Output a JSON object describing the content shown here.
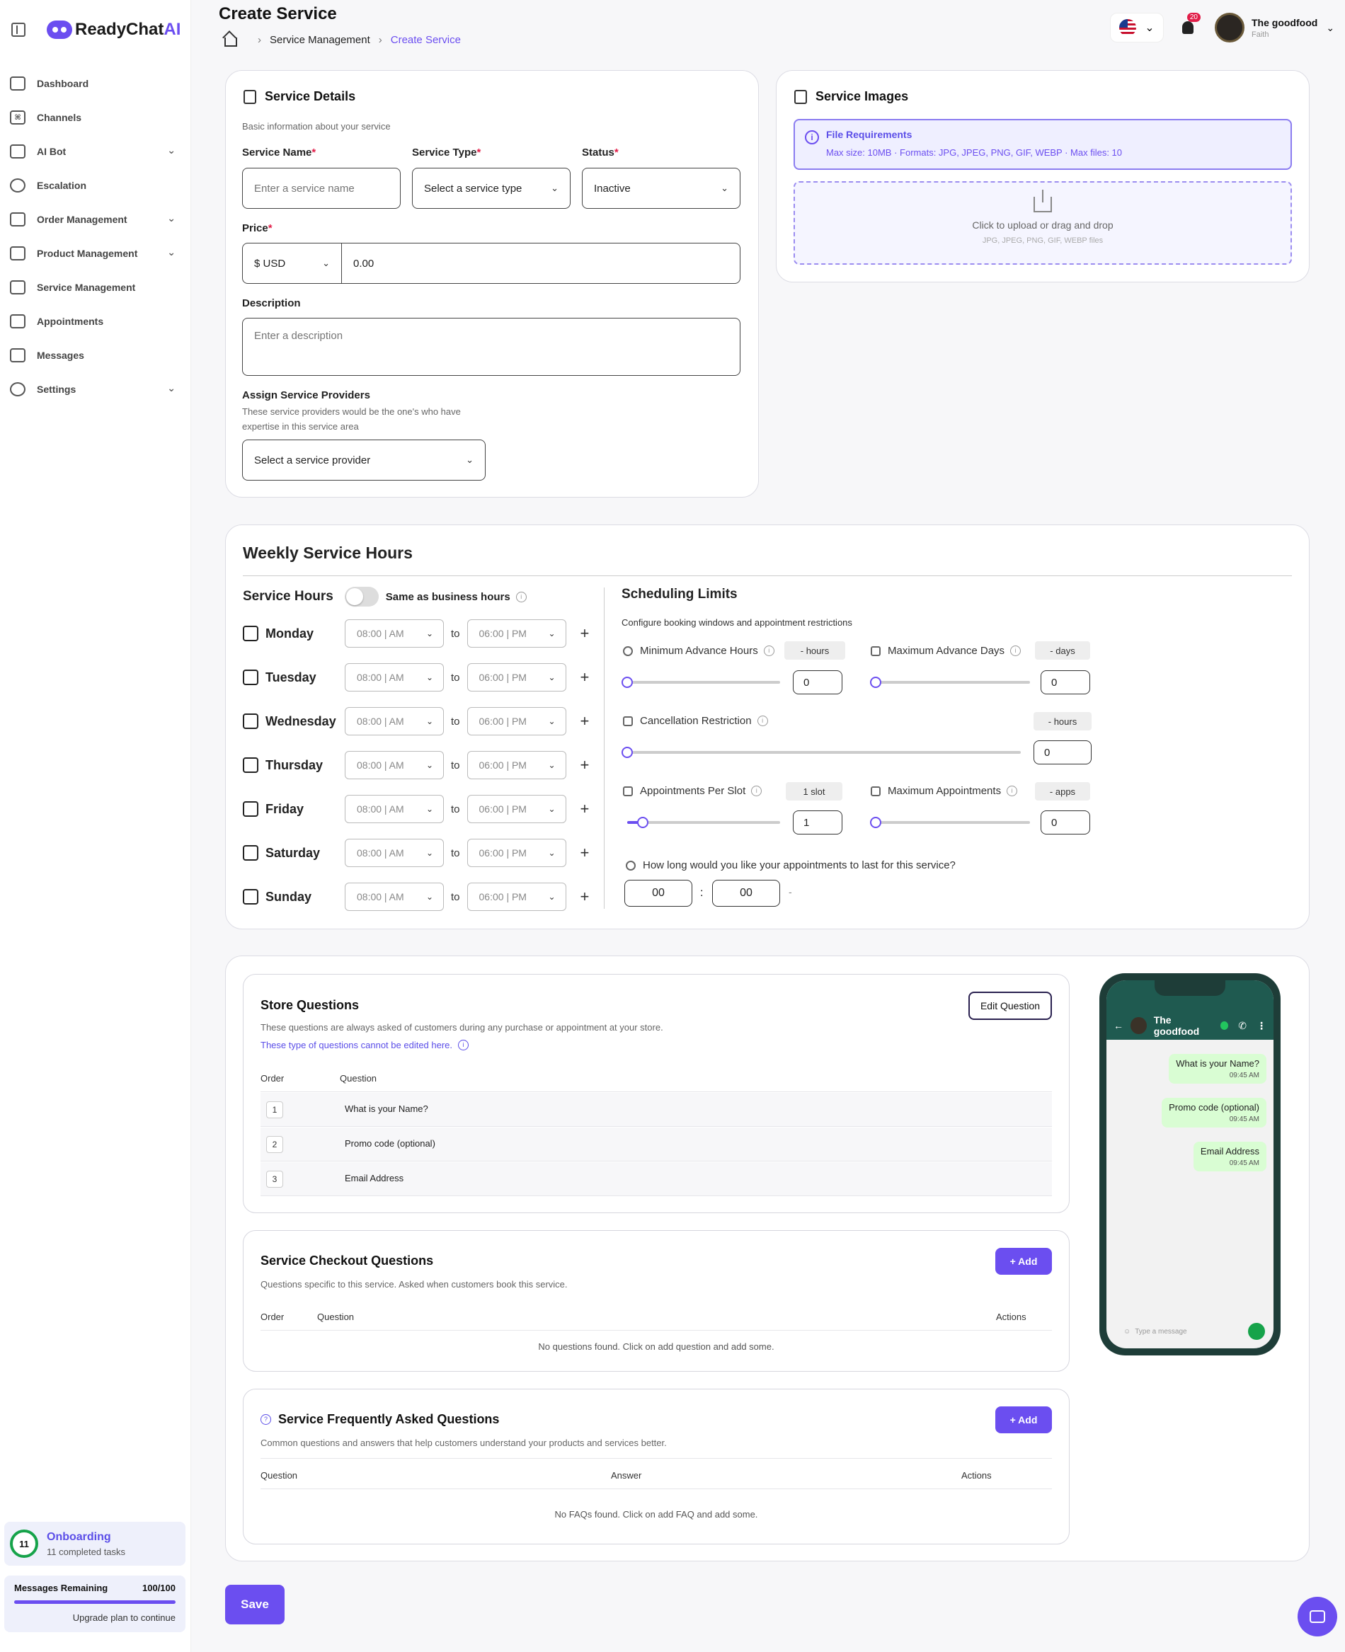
{
  "app": {
    "logo_main": "ReadyChat",
    "logo_ai": "AI"
  },
  "sidebar": {
    "items": [
      {
        "label": "Dashboard",
        "icon": "grid-icon",
        "has_children": false
      },
      {
        "label": "Channels",
        "icon": "command-icon",
        "has_children": false
      },
      {
        "label": "AI Bot",
        "icon": "bot-icon",
        "has_children": true
      },
      {
        "label": "Escalation",
        "icon": "headset-icon",
        "has_children": false
      },
      {
        "label": "Order Management",
        "icon": "box-icon",
        "has_children": true
      },
      {
        "label": "Product Management",
        "icon": "basket-icon",
        "has_children": true
      },
      {
        "label": "Service Management",
        "icon": "briefcase-icon",
        "has_children": false
      },
      {
        "label": "Appointments",
        "icon": "calendar-icon",
        "has_children": false
      },
      {
        "label": "Messages",
        "icon": "message-icon",
        "has_children": false
      },
      {
        "label": "Settings",
        "icon": "gear-icon",
        "has_children": true
      }
    ],
    "onboarding": {
      "count": "11",
      "title": "Onboarding",
      "subtitle": "11 completed tasks"
    },
    "messages": {
      "label": "Messages Remaining",
      "value": "100/100",
      "upgrade": "Upgrade plan to continue",
      "fraction": 1.0
    }
  },
  "header": {
    "title": "Create Service",
    "breadcrumb": [
      "Service Management",
      "Create Service"
    ],
    "notifications": "20",
    "user_name": "The goodfood",
    "user_sub": "Faith"
  },
  "service_details": {
    "title": "Service Details",
    "subtitle": "Basic information about your service",
    "name_label": "Service Name",
    "name_placeholder": "Enter a service name",
    "type_label": "Service Type",
    "type_value": "Select a service type",
    "status_label": "Status",
    "status_value": "Inactive",
    "price_label": "Price",
    "currency": "$ USD",
    "price_value": "0.00",
    "description_label": "Description",
    "description_placeholder": "Enter a description",
    "providers_label": "Assign Service Providers",
    "providers_help_1": "These service providers would be the one's who have",
    "providers_help_2": "expertise in this service area",
    "providers_value": "Select a service provider"
  },
  "service_images": {
    "title": "Service Images",
    "req_title": "File Requirements",
    "req_text": "Max size: 10MB · Formats: JPG, JPEG, PNG, GIF, WEBP · Max files: 10",
    "drop_text": "Click to upload or drag and drop",
    "drop_sub": "JPG, JPEG, PNG, GIF, WEBP files"
  },
  "weekly": {
    "title": "Weekly Service Hours",
    "hours_label": "Service Hours",
    "same_label": "Same as business hours",
    "to": "to",
    "days": [
      {
        "name": "Monday",
        "start": "08:00 | AM",
        "end": "06:00 | PM"
      },
      {
        "name": "Tuesday",
        "start": "08:00 | AM",
        "end": "06:00 | PM"
      },
      {
        "name": "Wednesday",
        "start": "08:00 | AM",
        "end": "06:00 | PM"
      },
      {
        "name": "Thursday",
        "start": "08:00 | AM",
        "end": "06:00 | PM"
      },
      {
        "name": "Friday",
        "start": "08:00 | AM",
        "end": "06:00 | PM"
      },
      {
        "name": "Saturday",
        "start": "08:00 | AM",
        "end": "06:00 | PM"
      },
      {
        "name": "Sunday",
        "start": "08:00 | AM",
        "end": "06:00 | PM"
      }
    ]
  },
  "limits": {
    "title": "Scheduling Limits",
    "subtitle": "Configure booking windows and appointment restrictions",
    "min_advance": {
      "label": "Minimum Advance Hours",
      "pill": "- hours",
      "value": "0",
      "level": 0
    },
    "max_advance": {
      "label": "Maximum Advance Days",
      "pill": "- days",
      "value": "0",
      "level": 0
    },
    "cancellation": {
      "label": "Cancellation Restriction",
      "pill": "- hours",
      "value": "0",
      "level": 0
    },
    "per_slot": {
      "label": "Appointments Per Slot",
      "pill": "1 slot",
      "value": "1",
      "level": 0.1
    },
    "max_appts": {
      "label": "Maximum Appointments",
      "pill": "- apps",
      "value": "0",
      "level": 0
    },
    "duration_label": "How long would you like your appointments to last for this service?",
    "duration_h": "00",
    "duration_m": "00",
    "duration_sep": ":",
    "duration_dash": "-"
  },
  "store_questions": {
    "title": "Store Questions",
    "subtitle": "These questions are always asked of customers during any purchase or appointment at your store.",
    "note": "These type of questions cannot be edited here.",
    "edit_button": "Edit Question",
    "col_order": "Order",
    "col_question": "Question",
    "rows": [
      {
        "order": "1",
        "question": "What is your Name?"
      },
      {
        "order": "2",
        "question": "Promo code (optional)"
      },
      {
        "order": "3",
        "question": "Email Address"
      }
    ]
  },
  "checkout_questions": {
    "title": "Service Checkout Questions",
    "subtitle": "Questions specific to this service. Asked when customers book this service.",
    "add_button": "+ Add",
    "col_order": "Order",
    "col_question": "Question",
    "col_actions": "Actions",
    "empty": "No questions found. Click on add question and add some."
  },
  "faq": {
    "title": "Service Frequently Asked Questions",
    "subtitle": "Common questions and answers that help customers understand your products and services better.",
    "add_button": "+ Add",
    "col_question": "Question",
    "col_answer": "Answer",
    "col_actions": "Actions",
    "empty": "No FAQs found. Click on add FAQ and add some."
  },
  "phone": {
    "contact": "The goodfood",
    "messages": [
      {
        "text": "What is your Name?",
        "time": "09:45 AM"
      },
      {
        "text": "Promo code (optional)",
        "time": "09:45 AM"
      },
      {
        "text": "Email Address",
        "time": "09:45 AM"
      }
    ],
    "input_placeholder": "Type a message"
  },
  "footer": {
    "save": "Save"
  },
  "colors": {
    "accent": "#6b4ef0",
    "whatsapp_header": "#1f5a50",
    "bubble": "#d9fdd3"
  }
}
